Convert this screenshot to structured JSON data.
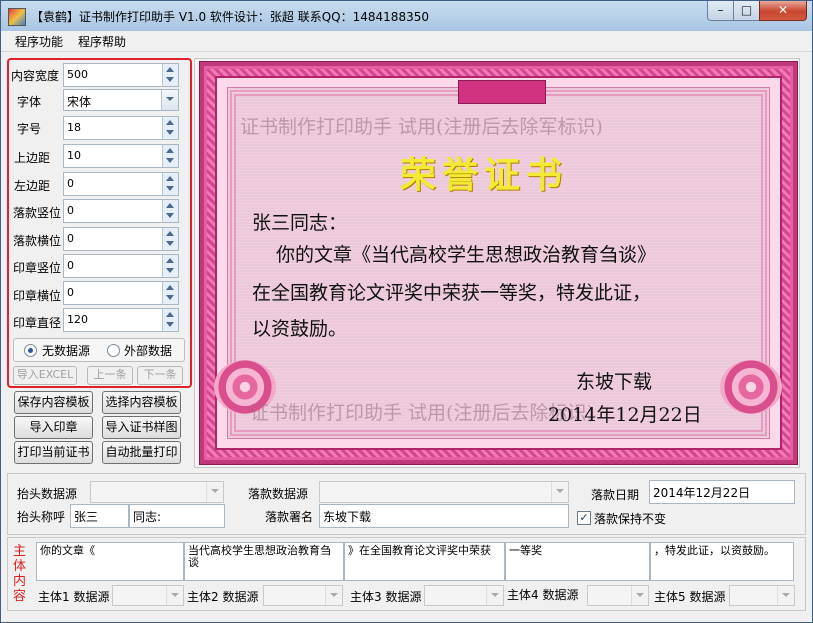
{
  "app": {
    "title": "【袁鹤】证书制作打印助手 V1.0    软件设计：张超  联系QQ：1484188350"
  },
  "window_controls": {
    "minimize": "–",
    "maximize": "□",
    "close": "✕"
  },
  "menu": {
    "items": [
      "程序功能",
      "程序帮助"
    ]
  },
  "left_panel": {
    "content_width": {
      "label": "内容宽度",
      "value": "500"
    },
    "font": {
      "label": "字体",
      "value": "宋体"
    },
    "font_size": {
      "label": "字号",
      "value": "18"
    },
    "top_margin": {
      "label": "上边距",
      "value": "10"
    },
    "left_margin": {
      "label": "左边距",
      "value": "0"
    },
    "sign_vpos": {
      "label": "落款竖位",
      "value": "0"
    },
    "sign_hpos": {
      "label": "落款横位",
      "value": "0"
    },
    "seal_vpos": {
      "label": "印章竖位",
      "value": "0"
    },
    "seal_hpos": {
      "label": "印章横位",
      "value": "0"
    },
    "seal_diameter": {
      "label": "印章直径",
      "value": "120"
    },
    "radio_no_source": "无数据源",
    "radio_external": "外部数据",
    "radio_selected": "无数据源",
    "import_excel": "导入EXCEL",
    "prev": "上一条",
    "next": "下一条"
  },
  "actions": {
    "save_template": "保存内容模板",
    "choose_template": "选择内容模板",
    "import_seal": "导入印章",
    "import_sample": "导入证书样图",
    "print_current": "打印当前证书",
    "auto_batch_print": "自动批量打印"
  },
  "certificate": {
    "watermark_top": "证书制作打印助手    试用(注册后去除军标识)",
    "watermark_bottom": "证书制作打印助手    试用(注册后去除标识)",
    "heading": "荣誉证书",
    "salutation": "张三同志：",
    "line1": "你的文章《当代高校学生思想政治教育刍谈》",
    "line2": "在全国教育论文评奖中荣获一等奖，特发此证，",
    "line3": "以资鼓励。",
    "signer": "东坡下载",
    "date": "2014年12月22日"
  },
  "header_fields": {
    "head_source_label": "抬头数据源",
    "head_source_value": "",
    "sign_source_label": "落款数据源",
    "sign_source_value": "",
    "sign_date_label": "落款日期",
    "sign_date_value": "2014年12月22日",
    "head_name_label": "抬头称呼",
    "head_name_value": "张三",
    "head_suffix_value": "同志:",
    "sign_name_label": "落款署名",
    "sign_name_value": "东坡下载",
    "keep_sign_label": "落款保持不变",
    "keep_sign_checked": "✓"
  },
  "body": {
    "label": "主体内容",
    "parts": [
      "你的文章《",
      "当代高校学生思想政治教育刍谈",
      "》在全国教育论文评奖中荣获",
      "一等奖",
      "，特发此证，以资鼓励。"
    ],
    "sources": [
      "主体1 数据源",
      "主体2 数据源",
      "主体3 数据源",
      "主体4 数据源",
      "主体5 数据源"
    ]
  },
  "colors": {
    "accent_red": "#e0202a",
    "cert_pink": "#c0397a",
    "heading_yellow": "#f2ea35"
  }
}
